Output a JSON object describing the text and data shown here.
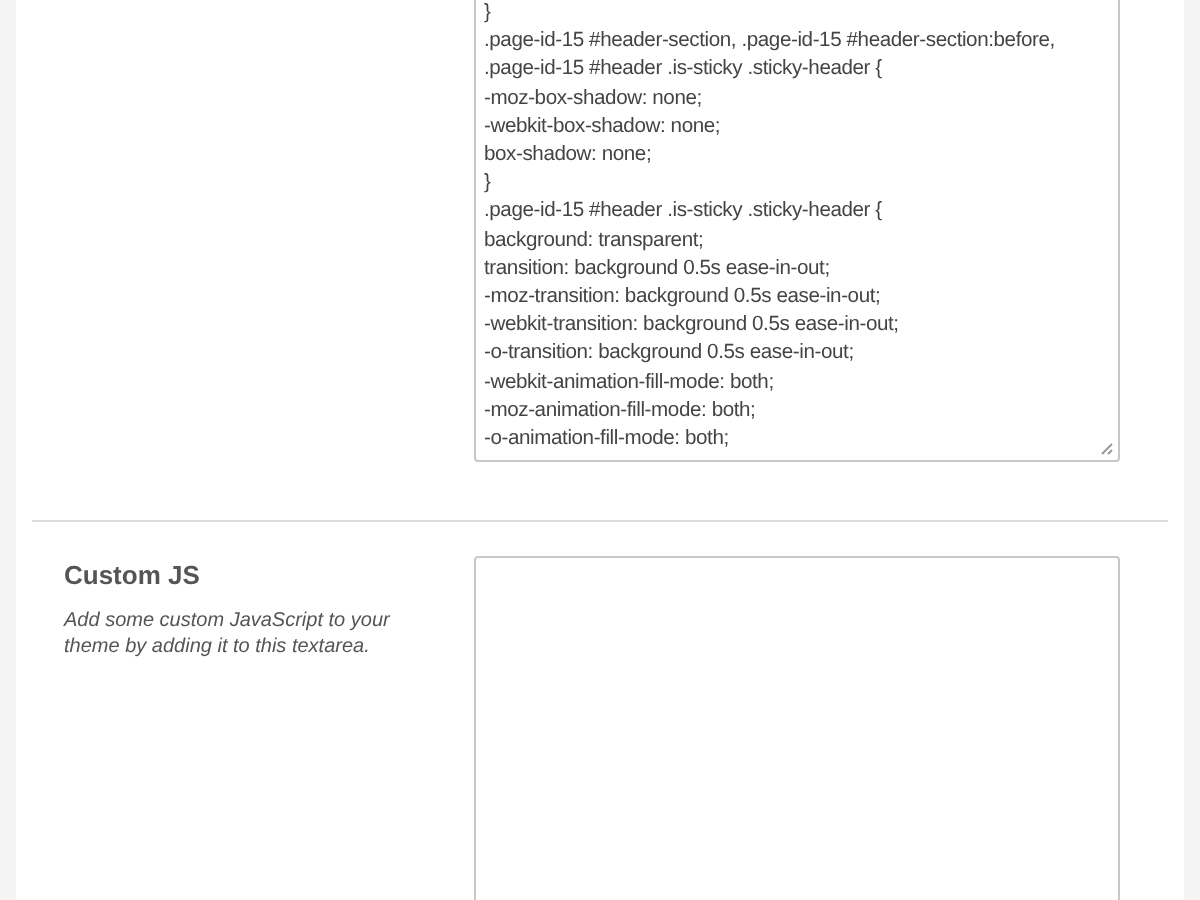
{
  "css_field": {
    "lines": [
      "}",
      ".page-id-15 #header-section, .page-id-15 #header-section:before,",
      ".page-id-15 #header .is-sticky .sticky-header {",
      "-moz-box-shadow: none;",
      "-webkit-box-shadow: none;",
      "box-shadow: none;",
      "}",
      ".page-id-15 #header .is-sticky .sticky-header {",
      "background: transparent;",
      "transition: background 0.5s ease-in-out;",
      "-moz-transition: background 0.5s ease-in-out;",
      "-webkit-transition: background 0.5s ease-in-out;",
      "-o-transition: background 0.5s ease-in-out;",
      "-webkit-animation-fill-mode: both;",
      "-moz-animation-fill-mode: both;",
      "-o-animation-fill-mode: both;"
    ]
  },
  "custom_js": {
    "title": "Custom JS",
    "description": "Add some custom JavaScript to your theme by adding it to this textarea."
  }
}
